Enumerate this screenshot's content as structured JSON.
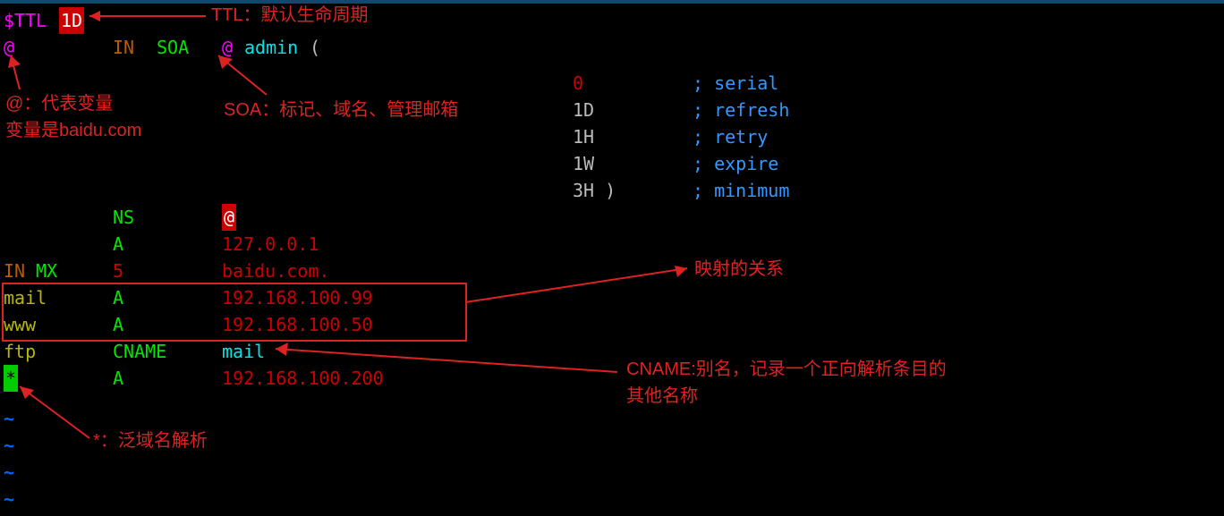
{
  "zone": {
    "ttl_directive": "$TTL",
    "ttl_value": "1D",
    "origin_at1": "@",
    "class1": "IN",
    "soa": "SOA",
    "origin_at2": "@",
    "admin": "admin",
    "paren_open": "(",
    "soa_fields": {
      "serial": {
        "val": "0",
        "comment": "; serial"
      },
      "refresh": {
        "val": "1D",
        "comment": "; refresh"
      },
      "retry": {
        "val": "1H",
        "comment": "; retry"
      },
      "expire": {
        "val": "1W",
        "comment": "; expire"
      },
      "minimum": {
        "val": "3H )",
        "comment": "; minimum"
      }
    },
    "r_ns": {
      "type": "NS",
      "data_at": "@"
    },
    "r_a1": {
      "type": "A",
      "data": "127.0.0.1"
    },
    "r_mx": {
      "class": "IN",
      "type": "MX",
      "prio": "5",
      "data": "baidu.com."
    },
    "r_mail": {
      "name": "mail",
      "type": "A",
      "data": "192.168.100.99"
    },
    "r_www": {
      "name": "www",
      "type": "A",
      "data": "192.168.100.50"
    },
    "r_ftp": {
      "name": "ftp",
      "type": "CNAME",
      "data": "mail"
    },
    "r_star": {
      "name": "*",
      "type": "A",
      "data": "192.168.100.200"
    }
  },
  "tildes": [
    "~",
    "~",
    "~",
    "~"
  ],
  "annotations": {
    "ttl": "TTL：默认生命周期",
    "at1": "@：代表变量",
    "at2": "变量是baidu.com",
    "soa": "SOA：标记、域名、管理邮箱",
    "map": "映射的关系",
    "cname1": "CNAME:别名，记录一个正向解析条目的",
    "cname2": "其他名称",
    "star": "*：泛域名解析"
  }
}
